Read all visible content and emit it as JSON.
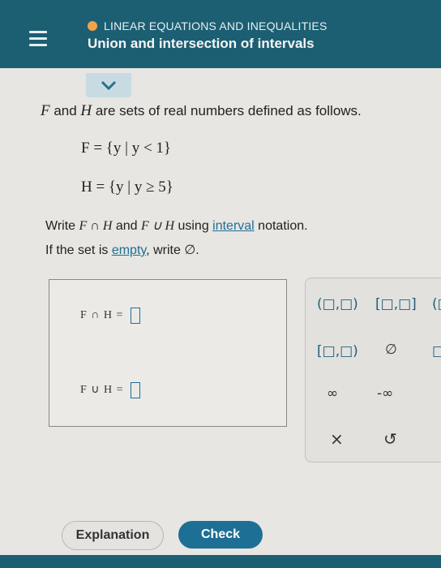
{
  "header": {
    "topic": "LINEAR EQUATIONS AND INEQUALITIES",
    "title": "Union and intersection of intervals",
    "accent": "#f2a34a",
    "bg": "#1c5f73"
  },
  "problem": {
    "intro_F": "F",
    "intro_and": " and ",
    "intro_H": "H",
    "intro_rest": " are sets of real numbers defined as follows.",
    "F_def": "F = {y | y < 1}",
    "H_def": "H = {y | y ≥ 5}",
    "instruct_1a": "Write ",
    "instruct_1b": "F ∩ H",
    "instruct_1c": " and ",
    "instruct_1d": "F ∪ H",
    "instruct_1e": " using ",
    "instruct_link": "interval",
    "instruct_1f": " notation.",
    "instruct_2a": "If the set is ",
    "instruct_2link": "empty",
    "instruct_2b": ", write ∅."
  },
  "answers": {
    "intersection_label": "F ∩ H =",
    "union_label": "F ∪ H ="
  },
  "keypad": {
    "k_open": "(□,□)",
    "k_closed": "[□,□]",
    "k_partial": "(□",
    "k_halfopen": "[□,□)",
    "k_empty": "∅",
    "k_box": "□",
    "k_inf": "∞",
    "k_neginf": "-∞",
    "k_clear": "×",
    "k_undo": "↺"
  },
  "buttons": {
    "explanation": "Explanation",
    "check": "Check"
  }
}
